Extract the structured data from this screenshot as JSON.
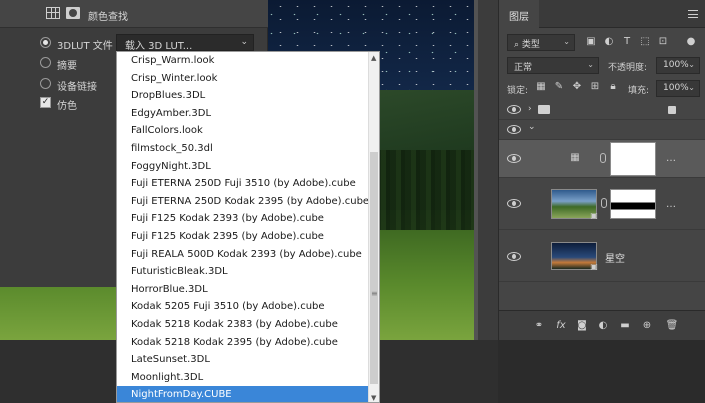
{
  "properties": {
    "title": "颜色查找",
    "options": [
      {
        "label": "3DLUT 文件",
        "selected": true
      },
      {
        "label": "摘要",
        "selected": false
      },
      {
        "label": "设备链接",
        "selected": false
      }
    ],
    "dither": {
      "label": "仿色",
      "checked": true
    },
    "dropdown_value": "载入 3D LUT..."
  },
  "lut_list": {
    "items": [
      "Crisp_Warm.look",
      "Crisp_Winter.look",
      "DropBlues.3DL",
      "EdgyAmber.3DL",
      "FallColors.look",
      "filmstock_50.3dl",
      "FoggyNight.3DL",
      "Fuji ETERNA 250D Fuji 3510 (by Adobe).cube",
      "Fuji ETERNA 250D Kodak 2395 (by Adobe).cube",
      "Fuji F125 Kodak 2393 (by Adobe).cube",
      "Fuji F125 Kodak 2395 (by Adobe).cube",
      "Fuji REALA 500D Kodak 2393 (by Adobe).cube",
      "FuturisticBleak.3DL",
      "HorrorBlue.3DL",
      "Kodak 5205 Fuji 3510 (by Adobe).cube",
      "Kodak 5218 Kodak 2383 (by Adobe).cube",
      "Kodak 5218 Kodak 2395 (by Adobe).cube",
      "LateSunset.3DL",
      "Moonlight.3DL",
      "NightFromDay.CUBE"
    ],
    "selected": "NightFromDay.CUBE"
  },
  "layers": {
    "tab": "图层",
    "kind_filter": "类型",
    "blend_mode": "正常",
    "opacity_label": "不透明度:",
    "opacity_value": "100%",
    "lock_label": "锁定:",
    "fill_label": "填充:",
    "fill_value": "100%",
    "rows": [
      {
        "name": "",
        "type": "group"
      },
      {
        "name": "",
        "type": "group-expanded"
      },
      {
        "name": "",
        "type": "color-lookup-adjustment",
        "active": true
      },
      {
        "name": "",
        "type": "masked-photo"
      },
      {
        "name": "星空",
        "type": "photo"
      }
    ]
  },
  "colors": {
    "selection": "#3a86d8",
    "panel_bg": "#454545",
    "dark_bg": "#2b2b2b"
  }
}
